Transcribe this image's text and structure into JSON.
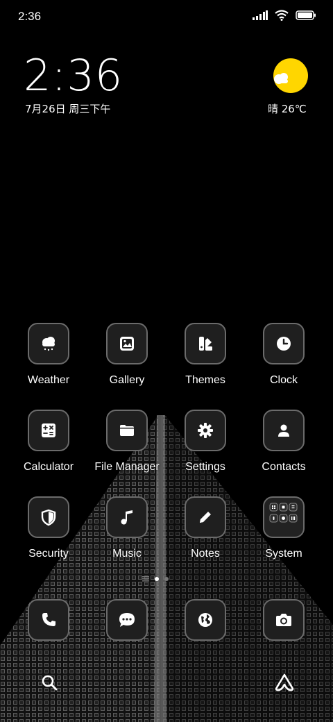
{
  "status_bar": {
    "time": "2:36"
  },
  "lockscreen_widget": {
    "clock": "2:36",
    "date": "7月26日 周三下午",
    "weather": "晴 26℃"
  },
  "apps": [
    {
      "label": "Weather",
      "icon": "weather-icon"
    },
    {
      "label": "Gallery",
      "icon": "gallery-icon"
    },
    {
      "label": "Themes",
      "icon": "themes-icon"
    },
    {
      "label": "Clock",
      "icon": "clock-icon"
    },
    {
      "label": "Calculator",
      "icon": "calculator-icon"
    },
    {
      "label": "File Manager",
      "icon": "folder-icon"
    },
    {
      "label": "Settings",
      "icon": "gear-icon"
    },
    {
      "label": "Contacts",
      "icon": "contacts-icon"
    },
    {
      "label": "Security",
      "icon": "shield-icon"
    },
    {
      "label": "Music",
      "icon": "music-icon"
    },
    {
      "label": "Notes",
      "icon": "pencil-icon"
    },
    {
      "label": "System",
      "icon": "folder-grid-icon"
    }
  ],
  "dock": [
    {
      "icon": "phone-icon"
    },
    {
      "icon": "messages-icon"
    },
    {
      "icon": "browser-icon"
    },
    {
      "icon": "camera-icon"
    }
  ],
  "colors": {
    "sun": "#FFD600",
    "tile_border": "#6b6b6b",
    "tile_bg": "#1f1f1f"
  }
}
